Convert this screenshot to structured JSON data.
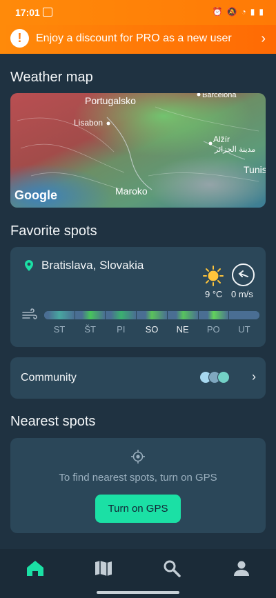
{
  "status_bar": {
    "time": "17:01"
  },
  "promo": {
    "text": "Enjoy a discount for PRO as a new user"
  },
  "weather_map": {
    "title": "Weather map",
    "places": [
      "Portugalsko",
      "Lisabon",
      "Barcelona",
      "Alžír",
      "مدينة الجزائر",
      "Maroko",
      "Tunis"
    ],
    "provider": "Google"
  },
  "favorite_spots": {
    "title": "Favorite spots",
    "spot": {
      "name": "Bratislava, Slovakia",
      "temperature": "9 °C",
      "wind": "0 m/s",
      "days": [
        "ST",
        "ŠT",
        "PI",
        "SO",
        "NE",
        "PO",
        "UT"
      ],
      "highlighted_days": [
        "SO",
        "NE"
      ],
      "forecast_segments": [
        {
          "color": "#4a6e93",
          "accent": "#48a7a0",
          "fraction": 0.72
        },
        {
          "color": "#4a6e93",
          "accent": "#47c45c",
          "fraction": 0.55
        },
        {
          "color": "#4a6e93",
          "accent": "#3ab06f",
          "fraction": 0.65
        },
        {
          "color": "#4a6e93",
          "accent": "#5ac25a",
          "fraction": 0.42
        },
        {
          "color": "#4a6e93",
          "accent": "#57c35d",
          "fraction": 0.45
        },
        {
          "color": "#4a6e93",
          "accent": "#62d35b",
          "fraction": 0.4
        },
        {
          "color": "#4a6e93",
          "accent": "#4a6e93",
          "fraction": 0.0
        }
      ]
    }
  },
  "community": {
    "label": "Community"
  },
  "nearest_spots": {
    "title": "Nearest spots",
    "message": "To find nearest spots, turn on GPS",
    "button": "Turn on GPS"
  },
  "bottom_nav": {
    "items": [
      {
        "name": "home",
        "icon": "home-icon",
        "active": true
      },
      {
        "name": "map",
        "icon": "map-icon",
        "active": false
      },
      {
        "name": "search",
        "icon": "search-icon",
        "active": false
      },
      {
        "name": "profile",
        "icon": "profile-icon",
        "active": false
      }
    ]
  },
  "colors": {
    "accent": "#1be0a5",
    "promo": "#ff7a06",
    "background": "#1f3241",
    "card": "#2b4759"
  }
}
